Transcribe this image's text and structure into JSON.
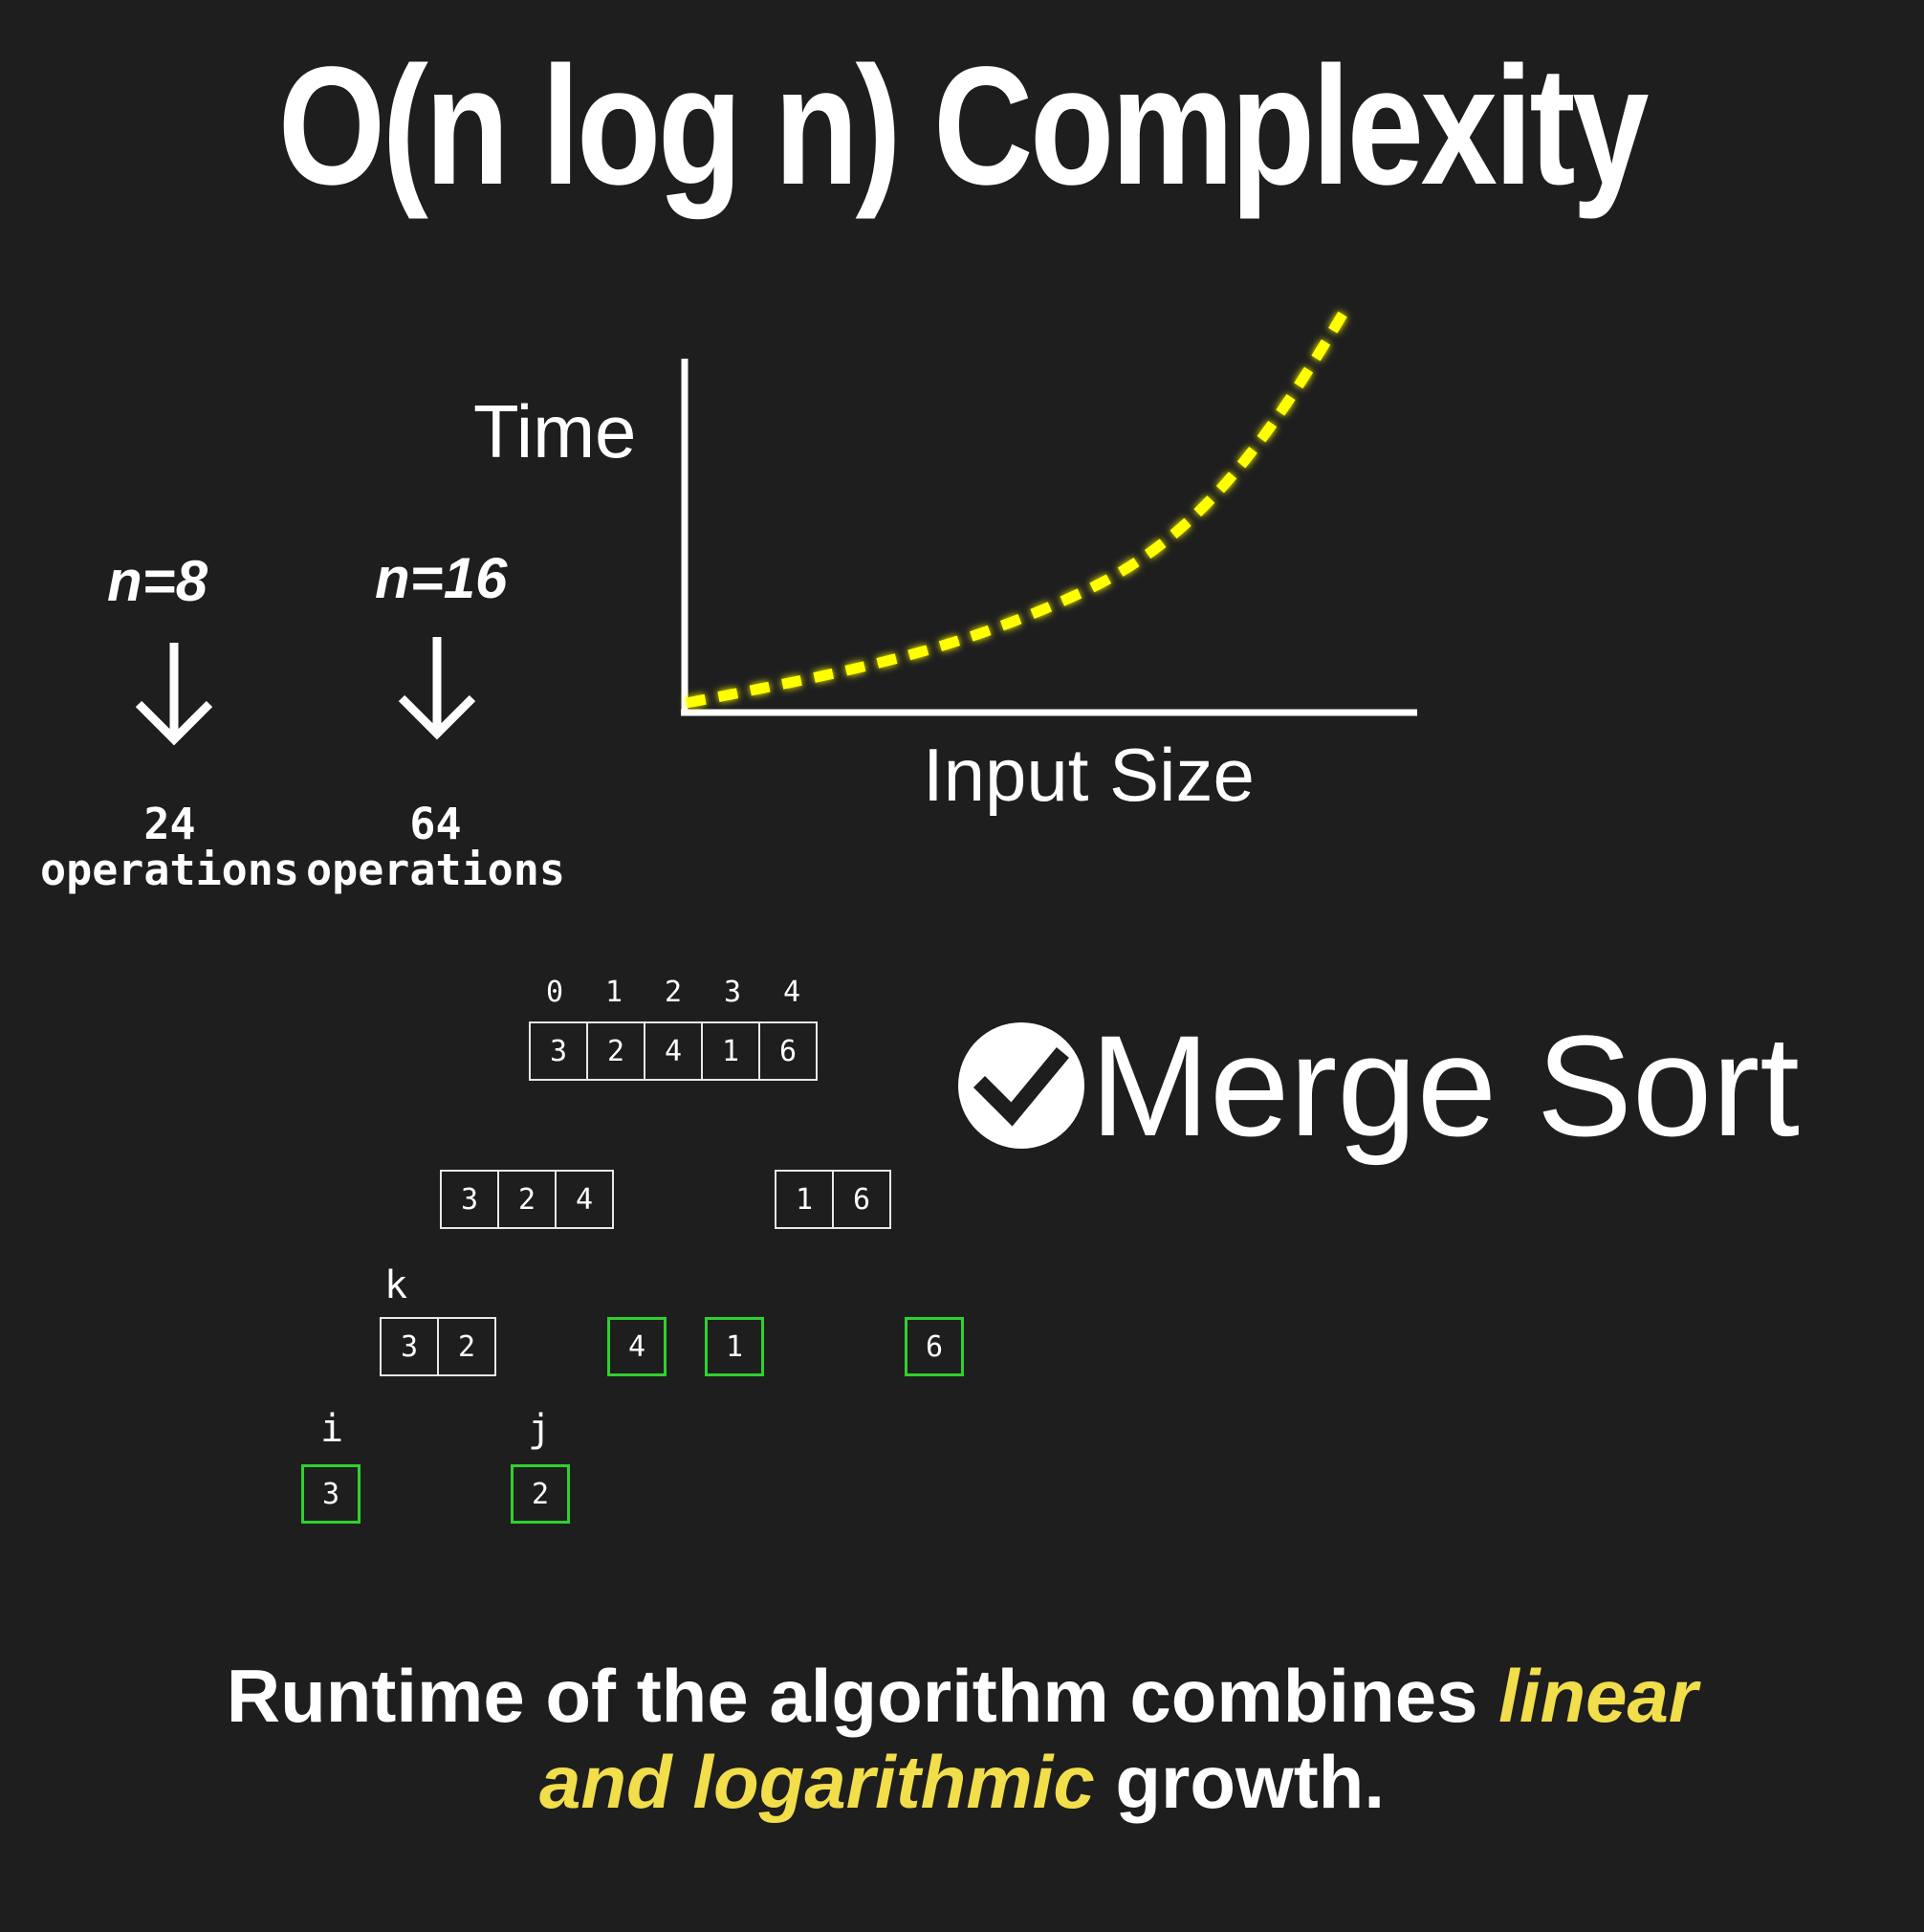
{
  "title": "O(n log n) Complexity",
  "graph": {
    "y_label": "Time",
    "x_label": "Input Size",
    "curve_color": "#ffff00"
  },
  "examples": [
    {
      "n_label": "n=8",
      "count": "24",
      "unit": "operations"
    },
    {
      "n_label": "n=16",
      "count": "64",
      "unit": "operations"
    }
  ],
  "merge_sort": {
    "label": "Merge Sort",
    "icon": "check-circle-icon",
    "indices": [
      "0",
      "1",
      "2",
      "3",
      "4"
    ],
    "level0": [
      "3",
      "2",
      "4",
      "1",
      "6"
    ],
    "level1_left": [
      "3",
      "2",
      "4"
    ],
    "level1_right": [
      "1",
      "6"
    ],
    "level2_pair": [
      "3",
      "2"
    ],
    "level2_singles": [
      "4",
      "1",
      "6"
    ],
    "level3": [
      "3",
      "2"
    ],
    "pointers": {
      "k": "k",
      "i": "i",
      "j": "j"
    },
    "highlight_color": "#2ed12e"
  },
  "caption": {
    "part1": "Runtime of the algorithm combines ",
    "highlight1": "linear",
    "highlight2": "and logarithmic",
    "part2": " growth.",
    "highlight_color": "#f1de4a"
  }
}
